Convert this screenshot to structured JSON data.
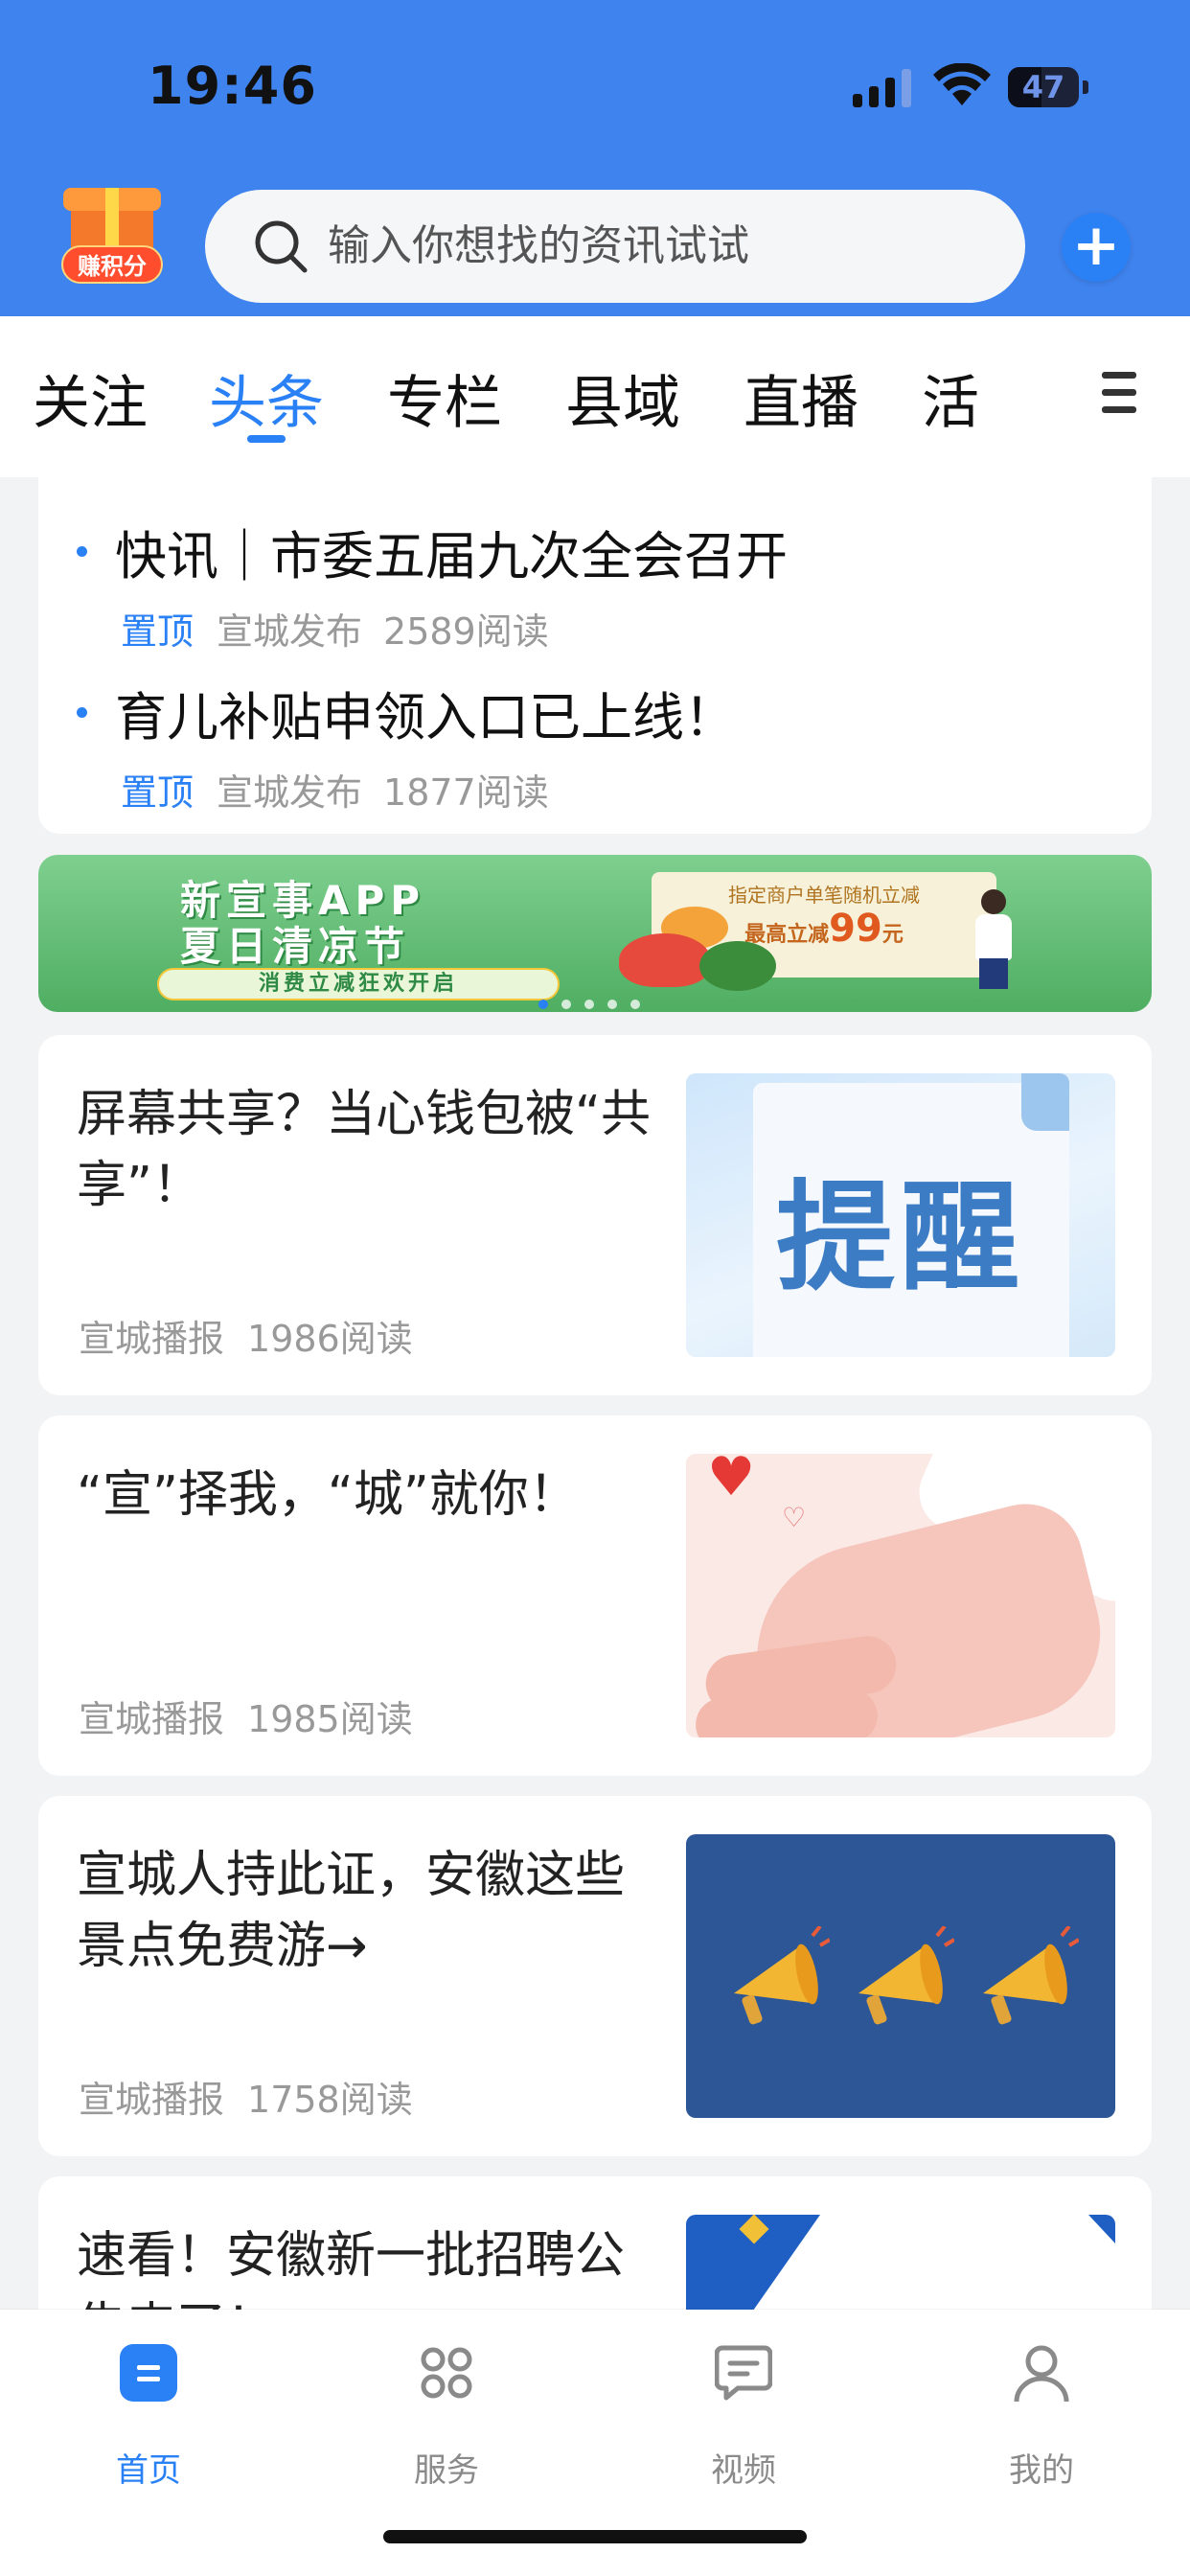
{
  "status_bar": {
    "time": "19:46",
    "battery": "47"
  },
  "header": {
    "points_badge_label": "赚积分",
    "search_placeholder": "输入你想找的资讯试试",
    "add_label": "+"
  },
  "channels": {
    "tabs": [
      {
        "label": "关注"
      },
      {
        "label": "头条",
        "active": true
      },
      {
        "label": "专栏"
      },
      {
        "label": "县域"
      },
      {
        "label": "直播"
      },
      {
        "label": "活"
      }
    ]
  },
  "pinned": [
    {
      "title": "快讯｜市委五届九次全会召开",
      "tag": "置顶",
      "source": "宣城发布",
      "reads": "2589阅读"
    },
    {
      "title": "育儿补贴申领入口已上线！",
      "tag": "置顶",
      "source": "宣城发布",
      "reads": "1877阅读"
    }
  ],
  "banner": {
    "title_line1": "新宣事APP",
    "title_line2": "夏日清凉节",
    "subtitle": "消费立减狂欢开启",
    "panel_top": "指定商户单笔随机立减",
    "panel_prefix": "最高立减",
    "panel_amount": "99",
    "panel_unit": "元",
    "slide_count": 5,
    "active_slide": 1
  },
  "news": [
    {
      "title": "屏幕共享？当心钱包被“共享”！",
      "source": "宣城播报",
      "reads": "1986阅读",
      "thumb_text": "提醒",
      "thumb_icon": "reminder-graphic"
    },
    {
      "title": "“宣”择我，“城”就你！",
      "source": "宣城播报",
      "reads": "1985阅读",
      "thumb_icon": "hands-heart-graphic"
    },
    {
      "title": "宣城人持此证，安徽这些景点免费游→",
      "source": "宣城播报",
      "reads": "1758阅读",
      "thumb_icon": "megaphone-graphic"
    },
    {
      "title": "速看！安徽新一批招聘公告来了！",
      "source": "",
      "reads": "",
      "thumb_icon": "blue-corner-graphic"
    }
  ],
  "tabbar": {
    "items": [
      {
        "label": "首页",
        "icon": "home-icon",
        "active": true
      },
      {
        "label": "服务",
        "icon": "services-icon"
      },
      {
        "label": "视频",
        "icon": "video-icon"
      },
      {
        "label": "我的",
        "icon": "profile-icon"
      }
    ]
  },
  "colors": {
    "header_blue": "#3f83ee",
    "accent": "#2a80f5",
    "meta_gray": "#999999"
  }
}
